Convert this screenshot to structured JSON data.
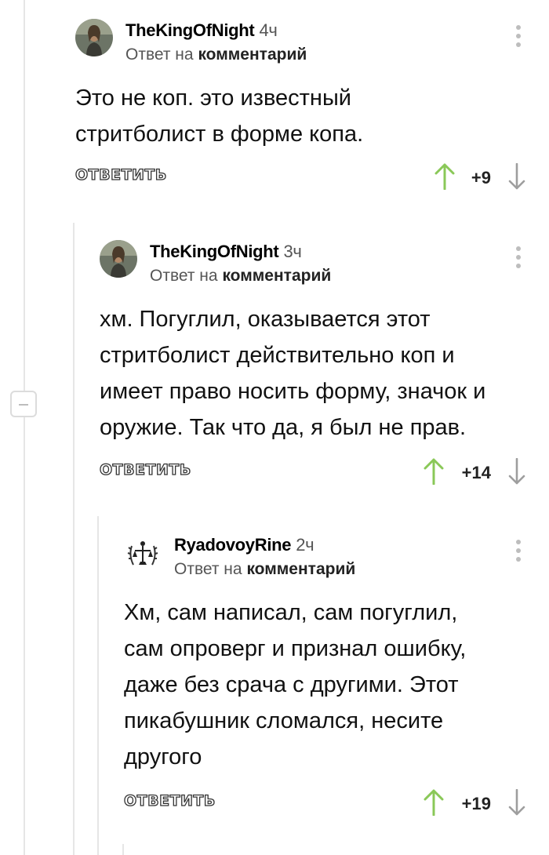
{
  "colors": {
    "upvote": "#8ac858",
    "downvote": "#9e9e9e",
    "thread_line": "#e6e6e6"
  },
  "comments": [
    {
      "author": "TheKingOfNight",
      "time": "4ч",
      "reply_prefix": "Ответ на",
      "reply_target": "комментарий",
      "lines": [
        "Это не коп. это известный",
        "стритболист в форме копа."
      ],
      "reply_label": "ОТВЕТИТЬ",
      "score": "+9",
      "avatar_icon": "user-portrait-icon"
    },
    {
      "author": "TheKingOfNight",
      "time": "3ч",
      "reply_prefix": "Ответ на",
      "reply_target": "комментарий",
      "lines": [
        "хм. Погуглил, оказывается этот",
        "стритболист действительно коп и",
        "имеет право носить форму, значок и",
        "оружие. Так что да, я был не прав."
      ],
      "reply_label": "ОТВЕТИТЬ",
      "score": "+14",
      "avatar_icon": "user-portrait-icon"
    },
    {
      "author": "RyadovoyRine",
      "time": "2ч",
      "reply_prefix": "Ответ на",
      "reply_target": "комментарий",
      "lines": [
        "Хм, сам написал, сам погуглил,",
        "сам опроверг и признал ошибку,",
        "даже без срача с другими. Этот",
        "пикабушник сломался, несите",
        "другого"
      ],
      "reply_label": "ОТВЕТИТЬ",
      "score": "+19",
      "avatar_icon": "justice-emblem-icon"
    }
  ]
}
